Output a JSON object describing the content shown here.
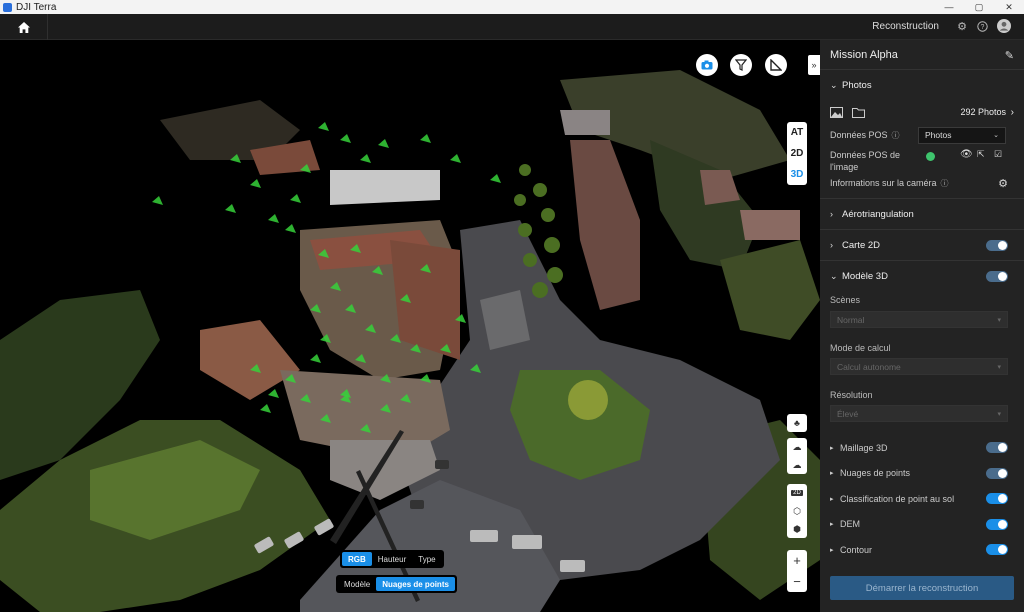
{
  "window": {
    "title": "DJI Terra",
    "minimize": "—",
    "maximize": "▢",
    "close": "✕"
  },
  "topnav": {
    "reconstruction_label": "Reconstruction"
  },
  "viewport": {
    "collapse_label": "»",
    "view_modes": [
      "AT",
      "2D",
      "3D"
    ],
    "active_view": "3D",
    "color_modes": [
      "RGB",
      "Hauteur",
      "Type"
    ],
    "active_color_mode": "RGB",
    "display_modes": [
      "Modèle",
      "Nuages de points"
    ],
    "active_display_mode": "Nuages de points",
    "zoom_in": "+",
    "zoom_out": "−",
    "tool_2d_label": "2D"
  },
  "panel": {
    "mission_name": "Mission Alpha",
    "photos_section": "Photos",
    "photo_count": "292 Photos",
    "pos_data_label": "Données POS",
    "pos_data_value": "Photos",
    "image_pos_label": "Données POS de l'image",
    "camera_info_label": "Informations sur la caméra",
    "aerotriangulation": "Aérotriangulation",
    "map2d": "Carte 2D",
    "model3d": "Modèle 3D",
    "scenes_label": "Scènes",
    "scenes_value": "Normal",
    "calc_mode_label": "Mode de calcul",
    "calc_mode_value": "Calcul autonome",
    "resolution_label": "Résolution",
    "resolution_value": "Élevé",
    "options": [
      {
        "label": "Maillage 3D",
        "on": false
      },
      {
        "label": "Nuages de points",
        "on": false
      },
      {
        "label": "Classification de point au sol",
        "on": true
      },
      {
        "label": "DEM",
        "on": true
      },
      {
        "label": "Contour",
        "on": true
      }
    ],
    "start_button": "Démarrer la reconstruction"
  },
  "colors": {
    "accent": "#1a8fe8",
    "panel_bg": "#232323",
    "camera_markers": "#36d13a"
  }
}
